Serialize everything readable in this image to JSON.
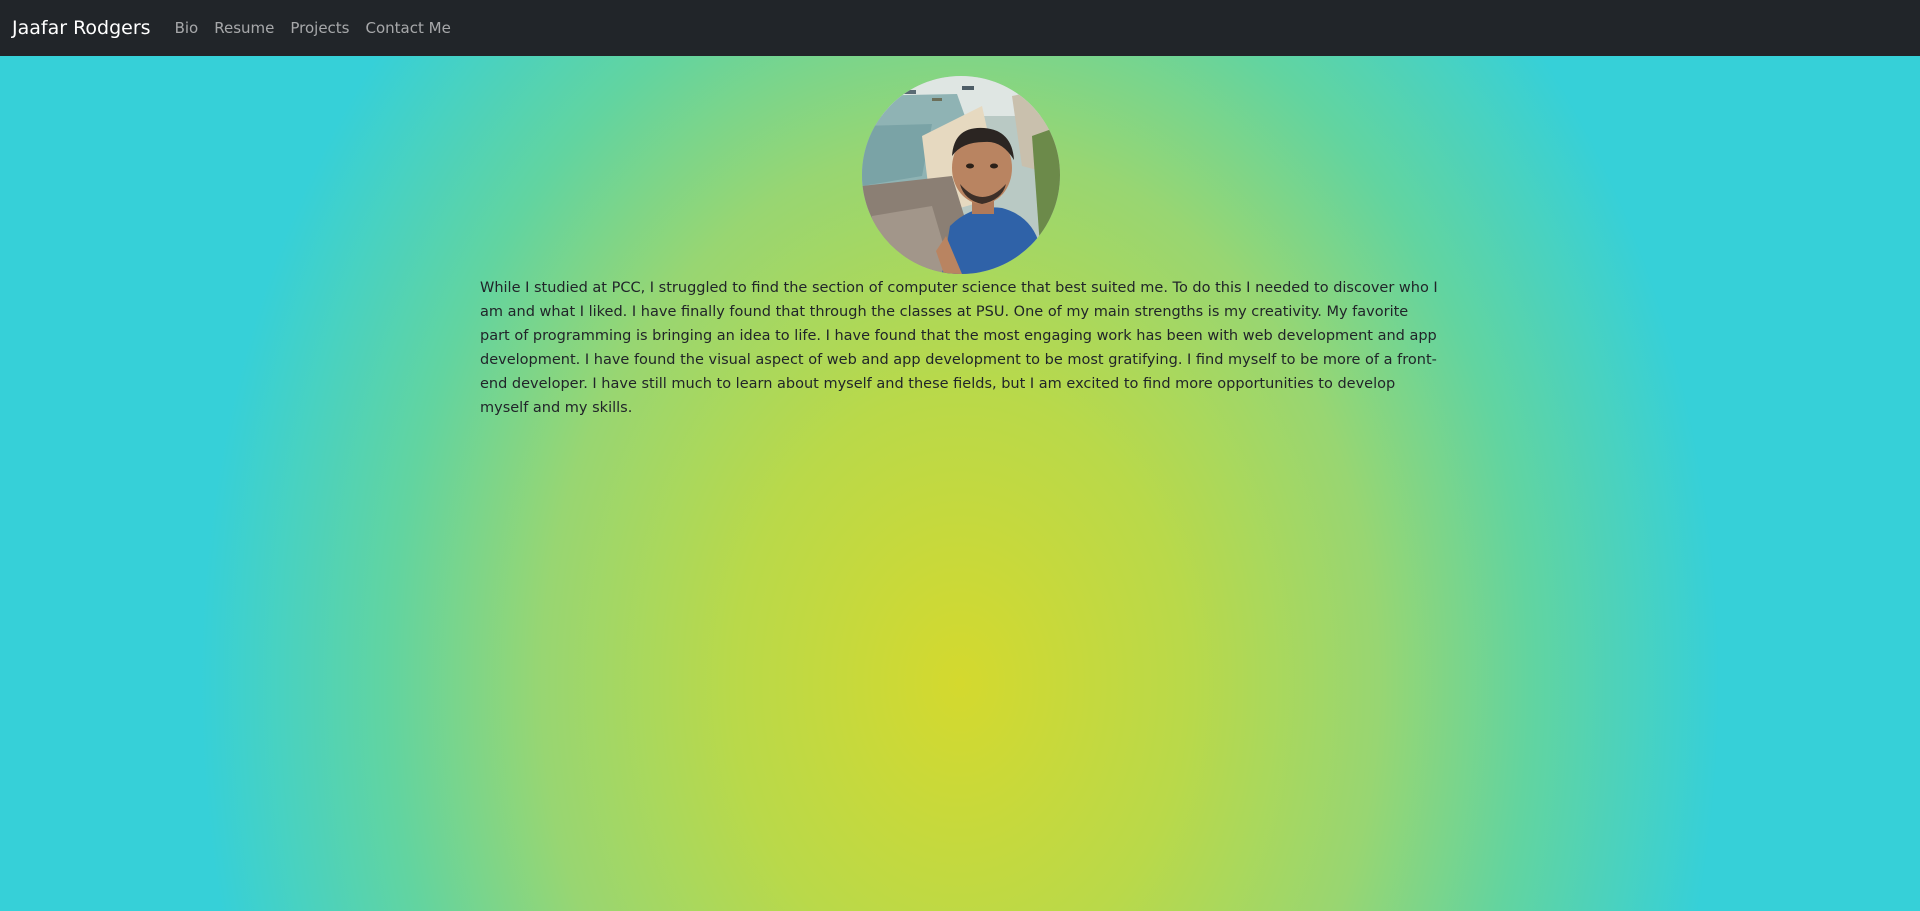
{
  "navbar": {
    "brand": "Jaafar Rodgers",
    "links": [
      {
        "label": "Bio"
      },
      {
        "label": "Resume"
      },
      {
        "label": "Projects"
      },
      {
        "label": "Contact Me"
      }
    ],
    "background": "#212529"
  },
  "profile": {
    "photo_icon": "profile-photo"
  },
  "bio": {
    "text": "While I studied at PCC, I struggled to find the section of computer science that best suited me. To do this I needed to discover who I am and what I liked. I have finally found that through the classes at PSU. One of my main strengths is my creativity. My favorite part of programming is bringing an idea to life. I have found that the most engaging work has been with web development and app development. I have found the visual aspect of web and app development to be most gratifying. I find myself to be more of a front-end developer. I have still much to learn about myself and these fields, but I am excited to find more opportunities to develop myself and my skills."
  },
  "colors": {
    "gradient_center": "#d4d92e",
    "gradient_edge": "#36d0d8"
  }
}
